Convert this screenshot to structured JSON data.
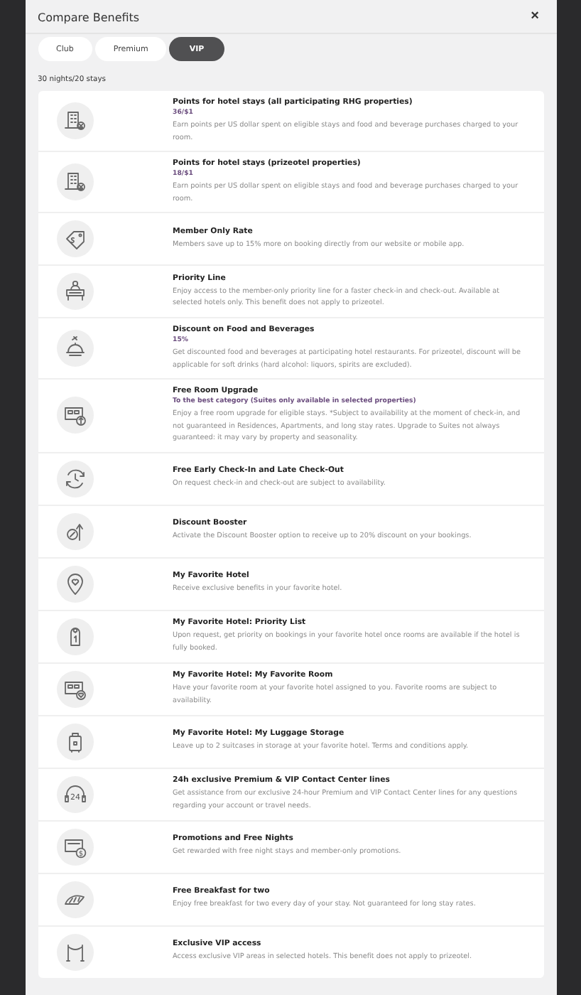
{
  "dialog": {
    "title": "Compare Benefits",
    "close": "×"
  },
  "tabs": [
    {
      "label": "Club",
      "selected": false
    },
    {
      "label": "Premium",
      "selected": false
    },
    {
      "label": "VIP",
      "selected": true
    }
  ],
  "tier_requirement": "30 nights/20 stays",
  "benefits": [
    {
      "title": "Points for hotel stays (all participating RHG properties)",
      "value": "36/$1",
      "description": "Earn points per US dollar spent on eligible stays and food and beverage purchases charged to your room."
    },
    {
      "title": "Points for hotel stays (prizeotel properties)",
      "value": "18/$1",
      "description": "Earn points per US dollar spent on eligible stays and food and beverage purchases charged to your room."
    },
    {
      "title": "Member Only Rate",
      "description": "Members save up to 15% more on booking directly from our website or mobile app."
    },
    {
      "title": "Priority Line",
      "description": "Enjoy access to the member-only priority line for a faster check-in and check-out. Available at selected hotels only. This benefit does not apply to prizeotel."
    },
    {
      "title": "Discount on Food and Beverages",
      "value": "15%",
      "description": "Get discounted food and beverages at participating hotel restaurants. For prizeotel, discount will be applicable for soft drinks (hard alcohol: liquors, spirits are excluded)."
    },
    {
      "title": "Free Room Upgrade",
      "value": "To the best category (Suites only available in selected properties)",
      "description": "Enjoy a free room upgrade for eligible stays. *Subject to availability at the moment of check-in, and not guaranteed in Residences, Apartments, and long stay rates. Upgrade to Suites not always guaranteed: it may vary by property and seasonality."
    },
    {
      "title": "Free Early Check-In and Late Check-Out",
      "description": "On request check-in and check-out are subject to availability."
    },
    {
      "title": "Discount Booster",
      "description": "Activate the Discount Booster option to receive up to 20% discount on your bookings."
    },
    {
      "title": "My Favorite Hotel",
      "description": "Receive exclusive benefits in your favorite hotel."
    },
    {
      "title": "My Favorite Hotel: Priority List",
      "description": "Upon request, get priority on bookings in your favorite hotel once rooms are available if the hotel is fully booked."
    },
    {
      "title": "My Favorite Hotel: My Favorite Room",
      "description": "Have your favorite room at your favorite hotel assigned to you. Favorite rooms are subject to availability."
    },
    {
      "title": "My Favorite Hotel: My Luggage Storage",
      "description": "Leave up to 2 suitcases in storage at your favorite hotel. Terms and conditions apply."
    },
    {
      "icon_label": "24",
      "title": "24h exclusive Premium & VIP Contact Center lines",
      "description": "Get assistance from our exclusive 24-hour Premium and VIP Contact Center lines for any questions regarding your account or travel needs."
    },
    {
      "icon_label": "$",
      "title": "Promotions and Free Nights",
      "description": "Get rewarded with free night stays and member-only promotions."
    },
    {
      "title": "Free Breakfast for two",
      "description": "Enjoy free breakfast for two every day of your stay. Not guaranteed for long stay rates."
    },
    {
      "title": "Exclusive VIP access",
      "description": "Access exclusive VIP areas in selected hotels. This benefit does not apply to prizeotel."
    }
  ]
}
